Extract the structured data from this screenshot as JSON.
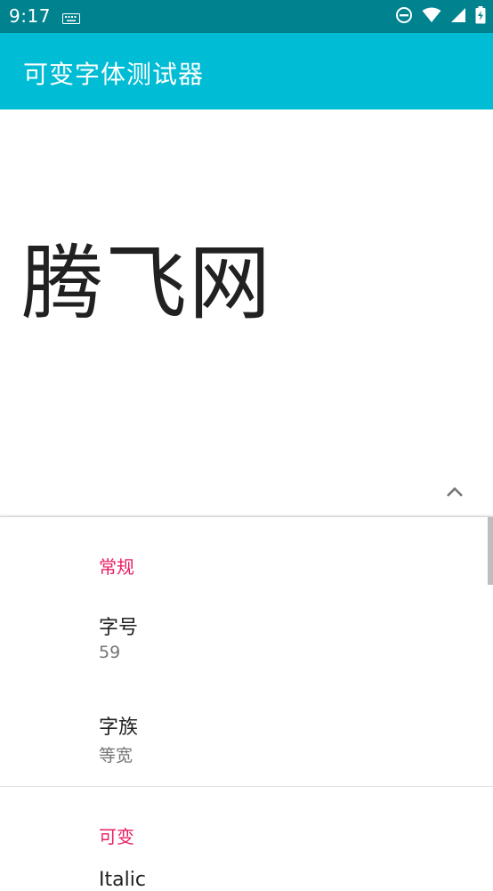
{
  "status_bar": {
    "time": "9:17",
    "icons": [
      "keyboard-icon",
      "do-not-disturb-icon",
      "wifi-icon",
      "signal-icon",
      "battery-icon"
    ]
  },
  "app_bar": {
    "title": "可变字体测试器"
  },
  "preview": {
    "text": "腾飞网"
  },
  "settings": {
    "general": {
      "header": "常规",
      "font_size": {
        "title": "字号",
        "value": "59"
      },
      "font_family": {
        "title": "字族",
        "value": "等宽"
      }
    },
    "variable": {
      "header": "可变",
      "next_item_partial": "Italic"
    }
  },
  "colors": {
    "status_bar": "#00838f",
    "app_bar": "#00bcd4",
    "accent": "#e91e63"
  }
}
